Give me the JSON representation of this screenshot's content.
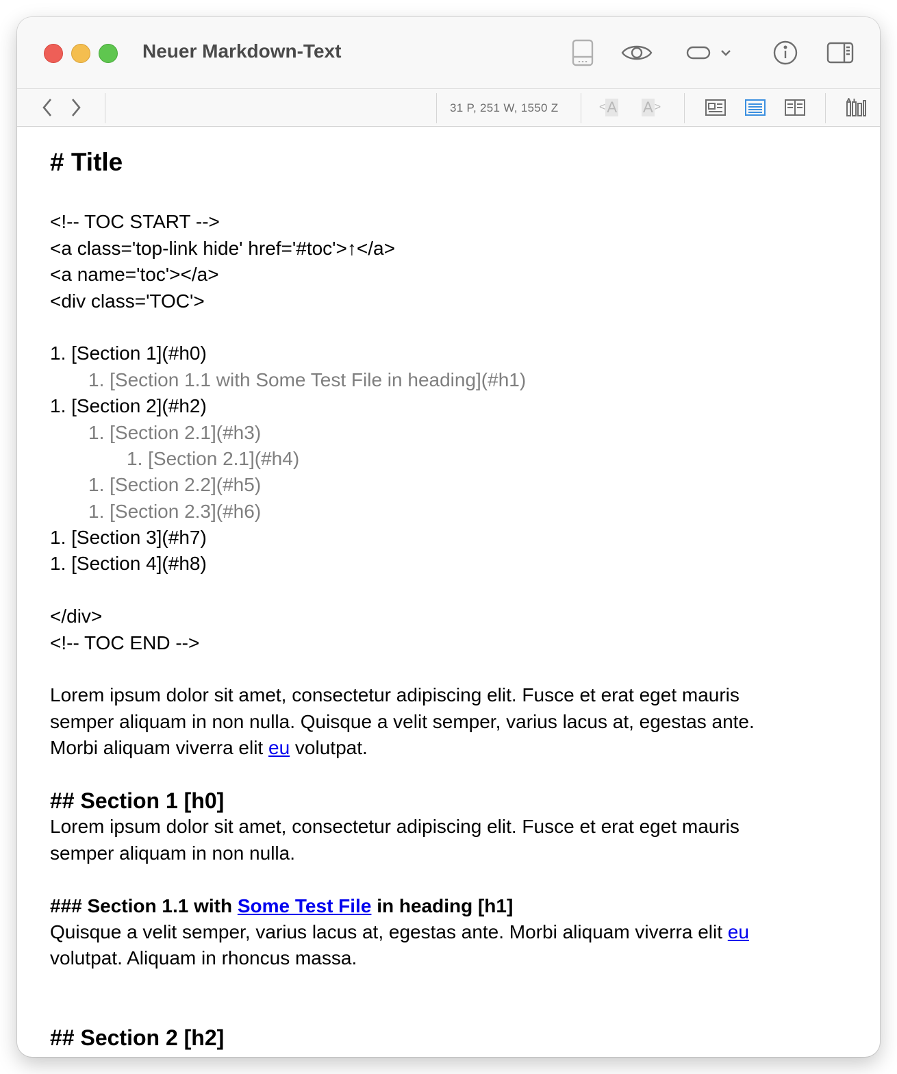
{
  "window": {
    "title": "Neuer Markdown-Text"
  },
  "titlebar_icons": [
    "save-document-icon",
    "eye-preview-icon",
    "pill-toggle-icon",
    "chevron-down-icon",
    "info-icon",
    "sidebar-icon"
  ],
  "toolbar": {
    "stats": "31 P, 251 W, 1550 Z",
    "font_smaller": "A",
    "font_larger": "A"
  },
  "document": {
    "title": "# Title",
    "toc_start": "<!-- TOC START -->",
    "toc_link": "<a class='top-link hide' href='#toc'>↑</a>",
    "toc_anchor": "<a name='toc'></a>",
    "toc_div_open": "<div class='TOC'>",
    "toc_items": [
      {
        "text": "1. [Section 1](#h0)"
      },
      {
        "text": "1. [Section 1.1 with Some Test File in heading](#h1)"
      },
      {
        "text": "1. [Section 2](#h2)"
      },
      {
        "text": "1. [Section 2.1](#h3)"
      },
      {
        "text": "1. [Section 2.1](#h4)"
      },
      {
        "text": "1. [Section 2.2](#h5)"
      },
      {
        "text": "1. [Section 2.3](#h6)"
      },
      {
        "text": "1. [Section 3](#h7)"
      },
      {
        "text": "1. [Section 4](#h8)"
      }
    ],
    "toc_div_close": "</div>",
    "toc_end": "<!-- TOC END -->",
    "intro": {
      "line1": "Lorem ipsum dolor sit amet, consectetur adipiscing elit. Fusce et erat eget mauris",
      "line2": "semper aliquam in non nulla. Quisque a velit semper, varius lacus at, egestas ante.",
      "line3_before": "Morbi aliquam viverra elit ",
      "line3_link": "eu",
      "line3_after": " volutpat."
    },
    "section1": {
      "heading": "## Section 1 [h0]",
      "line1": "Lorem ipsum dolor sit amet, consectetur adipiscing elit. Fusce et erat eget mauris",
      "line2": "semper aliquam in non nulla."
    },
    "section1_1": {
      "heading_before": "### Section 1.1 with ",
      "heading_link": "Some Test File",
      "heading_after": " in heading [h1]",
      "line1_before": "Quisque a velit semper, varius lacus at, egestas ante. Morbi aliquam viverra elit ",
      "line1_link": "eu",
      "line2": "volutpat. Aliquam in rhoncus massa."
    },
    "section2": {
      "heading": "## Section 2 [h2]"
    }
  },
  "colors": {
    "link": "#0000ee",
    "muted_text": "#7f7f7f",
    "active_view": "#3b8fe0"
  }
}
